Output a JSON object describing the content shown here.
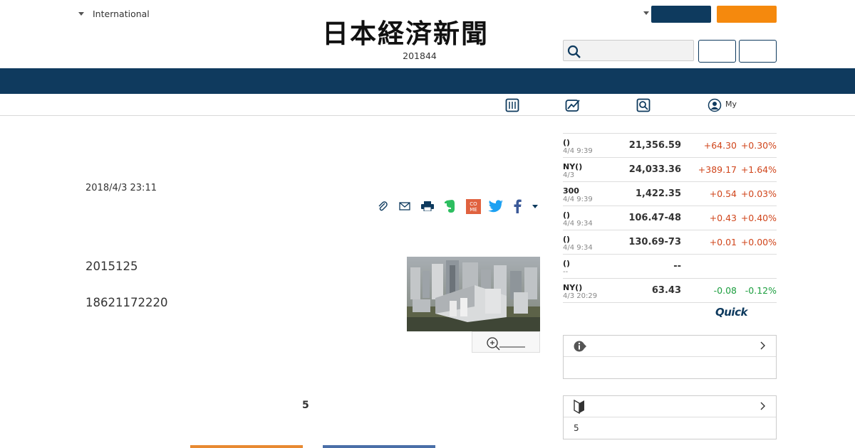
{
  "header": {
    "region_label": "International",
    "logo_text": "日本経済新聞",
    "edition_text": "201844"
  },
  "subnav": {
    "my_label": "My"
  },
  "article": {
    "date": "2018/4/3 23:11",
    "paragraph_1": "2015125",
    "paragraph_2": "18621172220",
    "related_count": "5"
  },
  "market": {
    "rows": [
      {
        "name": "()",
        "time": "4/4 9:39",
        "value": "21,356.59",
        "change": "+64.30",
        "percent": "+0.30%",
        "trend": "up"
      },
      {
        "name": "NY()",
        "time": "4/3",
        "value": "24,033.36",
        "change": "+389.17",
        "percent": "+1.64%",
        "trend": "up"
      },
      {
        "name": "300",
        "time": "4/4 9:39",
        "value": "1,422.35",
        "change": "+0.54",
        "percent": "+0.03%",
        "trend": "up"
      },
      {
        "name": "()",
        "time": "4/4 9:34",
        "value": "106.47-48",
        "change": "+0.43",
        "percent": "+0.40%",
        "trend": "up"
      },
      {
        "name": "()",
        "time": "4/4 9:34",
        "value": "130.69-73",
        "change": "+0.01",
        "percent": "+0.00%",
        "trend": "up"
      },
      {
        "name": "()",
        "time": "--",
        "value": "--",
        "change": "",
        "percent": "",
        "trend": "none"
      },
      {
        "name": "NY()",
        "time": "4/3 20:29",
        "value": "63.43",
        "change": "-0.08",
        "percent": "-0.12%",
        "trend": "down"
      }
    ],
    "provider_logo": "Quick"
  },
  "side_boxes": {
    "beginner_count": "5"
  },
  "colors": {
    "navy": "#0e3a5e",
    "orange": "#f5890d",
    "up": "#d0451b",
    "down": "#1b9e3e"
  }
}
